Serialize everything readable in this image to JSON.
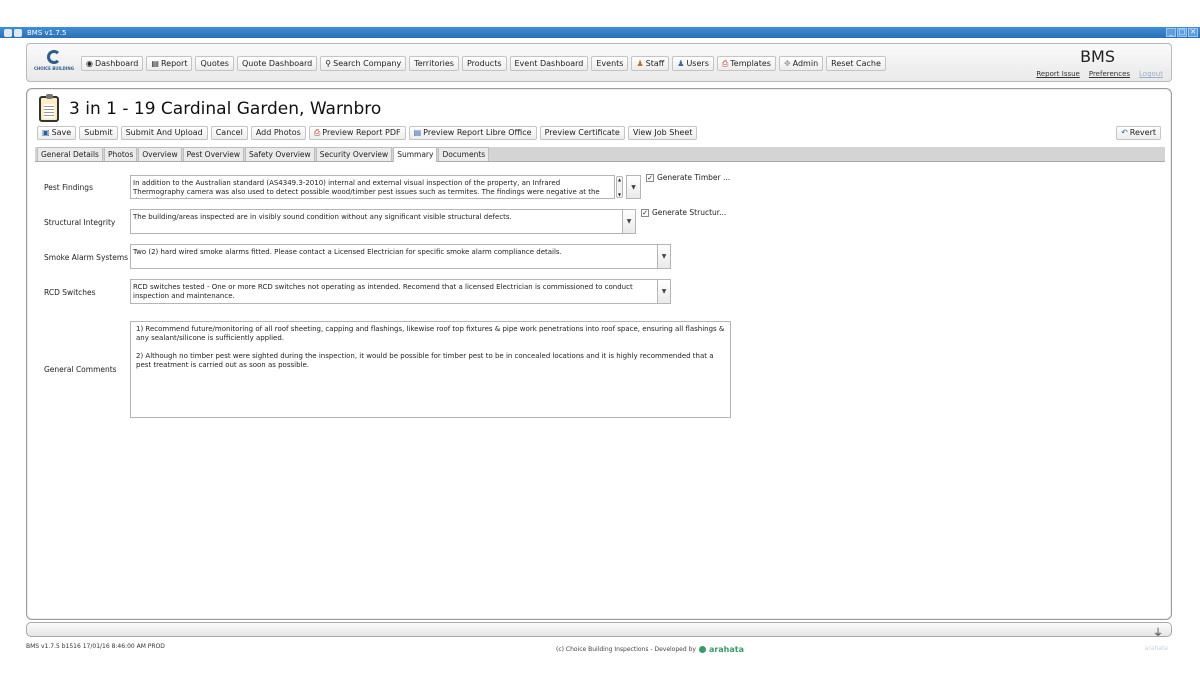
{
  "window": {
    "title": "BMS v1.7.5"
  },
  "logo": {
    "text": "CHOICE BUILDING"
  },
  "nav": [
    {
      "label": "Dashboard",
      "icon": "dashboard-icon"
    },
    {
      "label": "Report",
      "icon": "report-icon"
    },
    {
      "label": "Quotes"
    },
    {
      "label": "Quote Dashboard"
    },
    {
      "label": "Search Company",
      "icon": "search-icon"
    },
    {
      "label": "Territories"
    },
    {
      "label": "Products"
    },
    {
      "label": "Event Dashboard"
    },
    {
      "label": "Events"
    },
    {
      "label": "Staff",
      "icon": "staff-icon"
    },
    {
      "label": "Users",
      "icon": "users-icon"
    },
    {
      "label": "Templates",
      "icon": "templates-icon"
    },
    {
      "label": "Admin",
      "icon": "admin-icon"
    },
    {
      "label": "Reset Cache"
    }
  ],
  "brand": "BMS",
  "toplinks": {
    "report_issue": "Report Issue",
    "preferences": "Preferences",
    "logout": "Logout"
  },
  "page": {
    "title": "3 in 1 - 19 Cardinal Garden, Warnbro"
  },
  "toolbar": {
    "save": "Save",
    "submit": "Submit",
    "submit_upload": "Submit And Upload",
    "cancel": "Cancel",
    "add_photos": "Add Photos",
    "preview_pdf": "Preview Report PDF",
    "preview_libre": "Preview Report Libre Office",
    "preview_certificate": "Preview Certificate",
    "view_job_sheet": "View Job Sheet",
    "revert": "Revert"
  },
  "tabs": [
    {
      "label": "General Details"
    },
    {
      "label": "Photos"
    },
    {
      "label": "Overview"
    },
    {
      "label": "Pest Overview"
    },
    {
      "label": "Safety Overview"
    },
    {
      "label": "Security Overview"
    },
    {
      "label": "Summary",
      "active": true
    },
    {
      "label": "Documents"
    }
  ],
  "summary": {
    "pest_findings": {
      "label": "Pest Findings",
      "value": "In addition to the Australian standard (AS4349.3-2010) internal and external visual inspection of the property, an Infrared Thermography camera was also used to detect possible wood/timber pest issues such as termites. The findings were negative at the time of inspection.",
      "checkbox_label": "Generate Timber ...",
      "checked": true
    },
    "structural_integrity": {
      "label": "Structural Integrity",
      "value": "The building/areas inspected are in visibly sound condition without any significant visible structural defects.",
      "checkbox_label": "Generate Structur...",
      "checked": true
    },
    "smoke_alarm": {
      "label": "Smoke Alarm Systems",
      "value": "Two (2) hard wired smoke alarms fitted. Please contact a Licensed Electrician for specific smoke alarm compliance details."
    },
    "rcd_switches": {
      "label": "RCD Switches",
      "value": "RCD switches tested - One or more RCD switches not operating as intended. Recomend that a licensed Electrician is commissioned to conduct inspection and maintenance."
    },
    "general_comments": {
      "label": "General Comments",
      "p1": "1) Recommend future/monitoring of all roof sheeting, capping and flashings, likewise roof top fixtures & pipe work penetrations into roof space, ensuring all flashings & any sealant/silicone is sufficiently applied.",
      "p2": "2) Although no timber pest were sighted during the inspection, it would be possible for timber pest to be in concealed locations and it is highly recommended that a pest treatment is carried out as soon as possible."
    }
  },
  "status": {
    "build": "BMS v1.7.5 b1516 17/01/16 8:46:00 AM PROD"
  },
  "footer": {
    "copyright": "(c)  Choice Building Inspections  - Developed by",
    "developer": "arahata",
    "right": "arahata"
  }
}
